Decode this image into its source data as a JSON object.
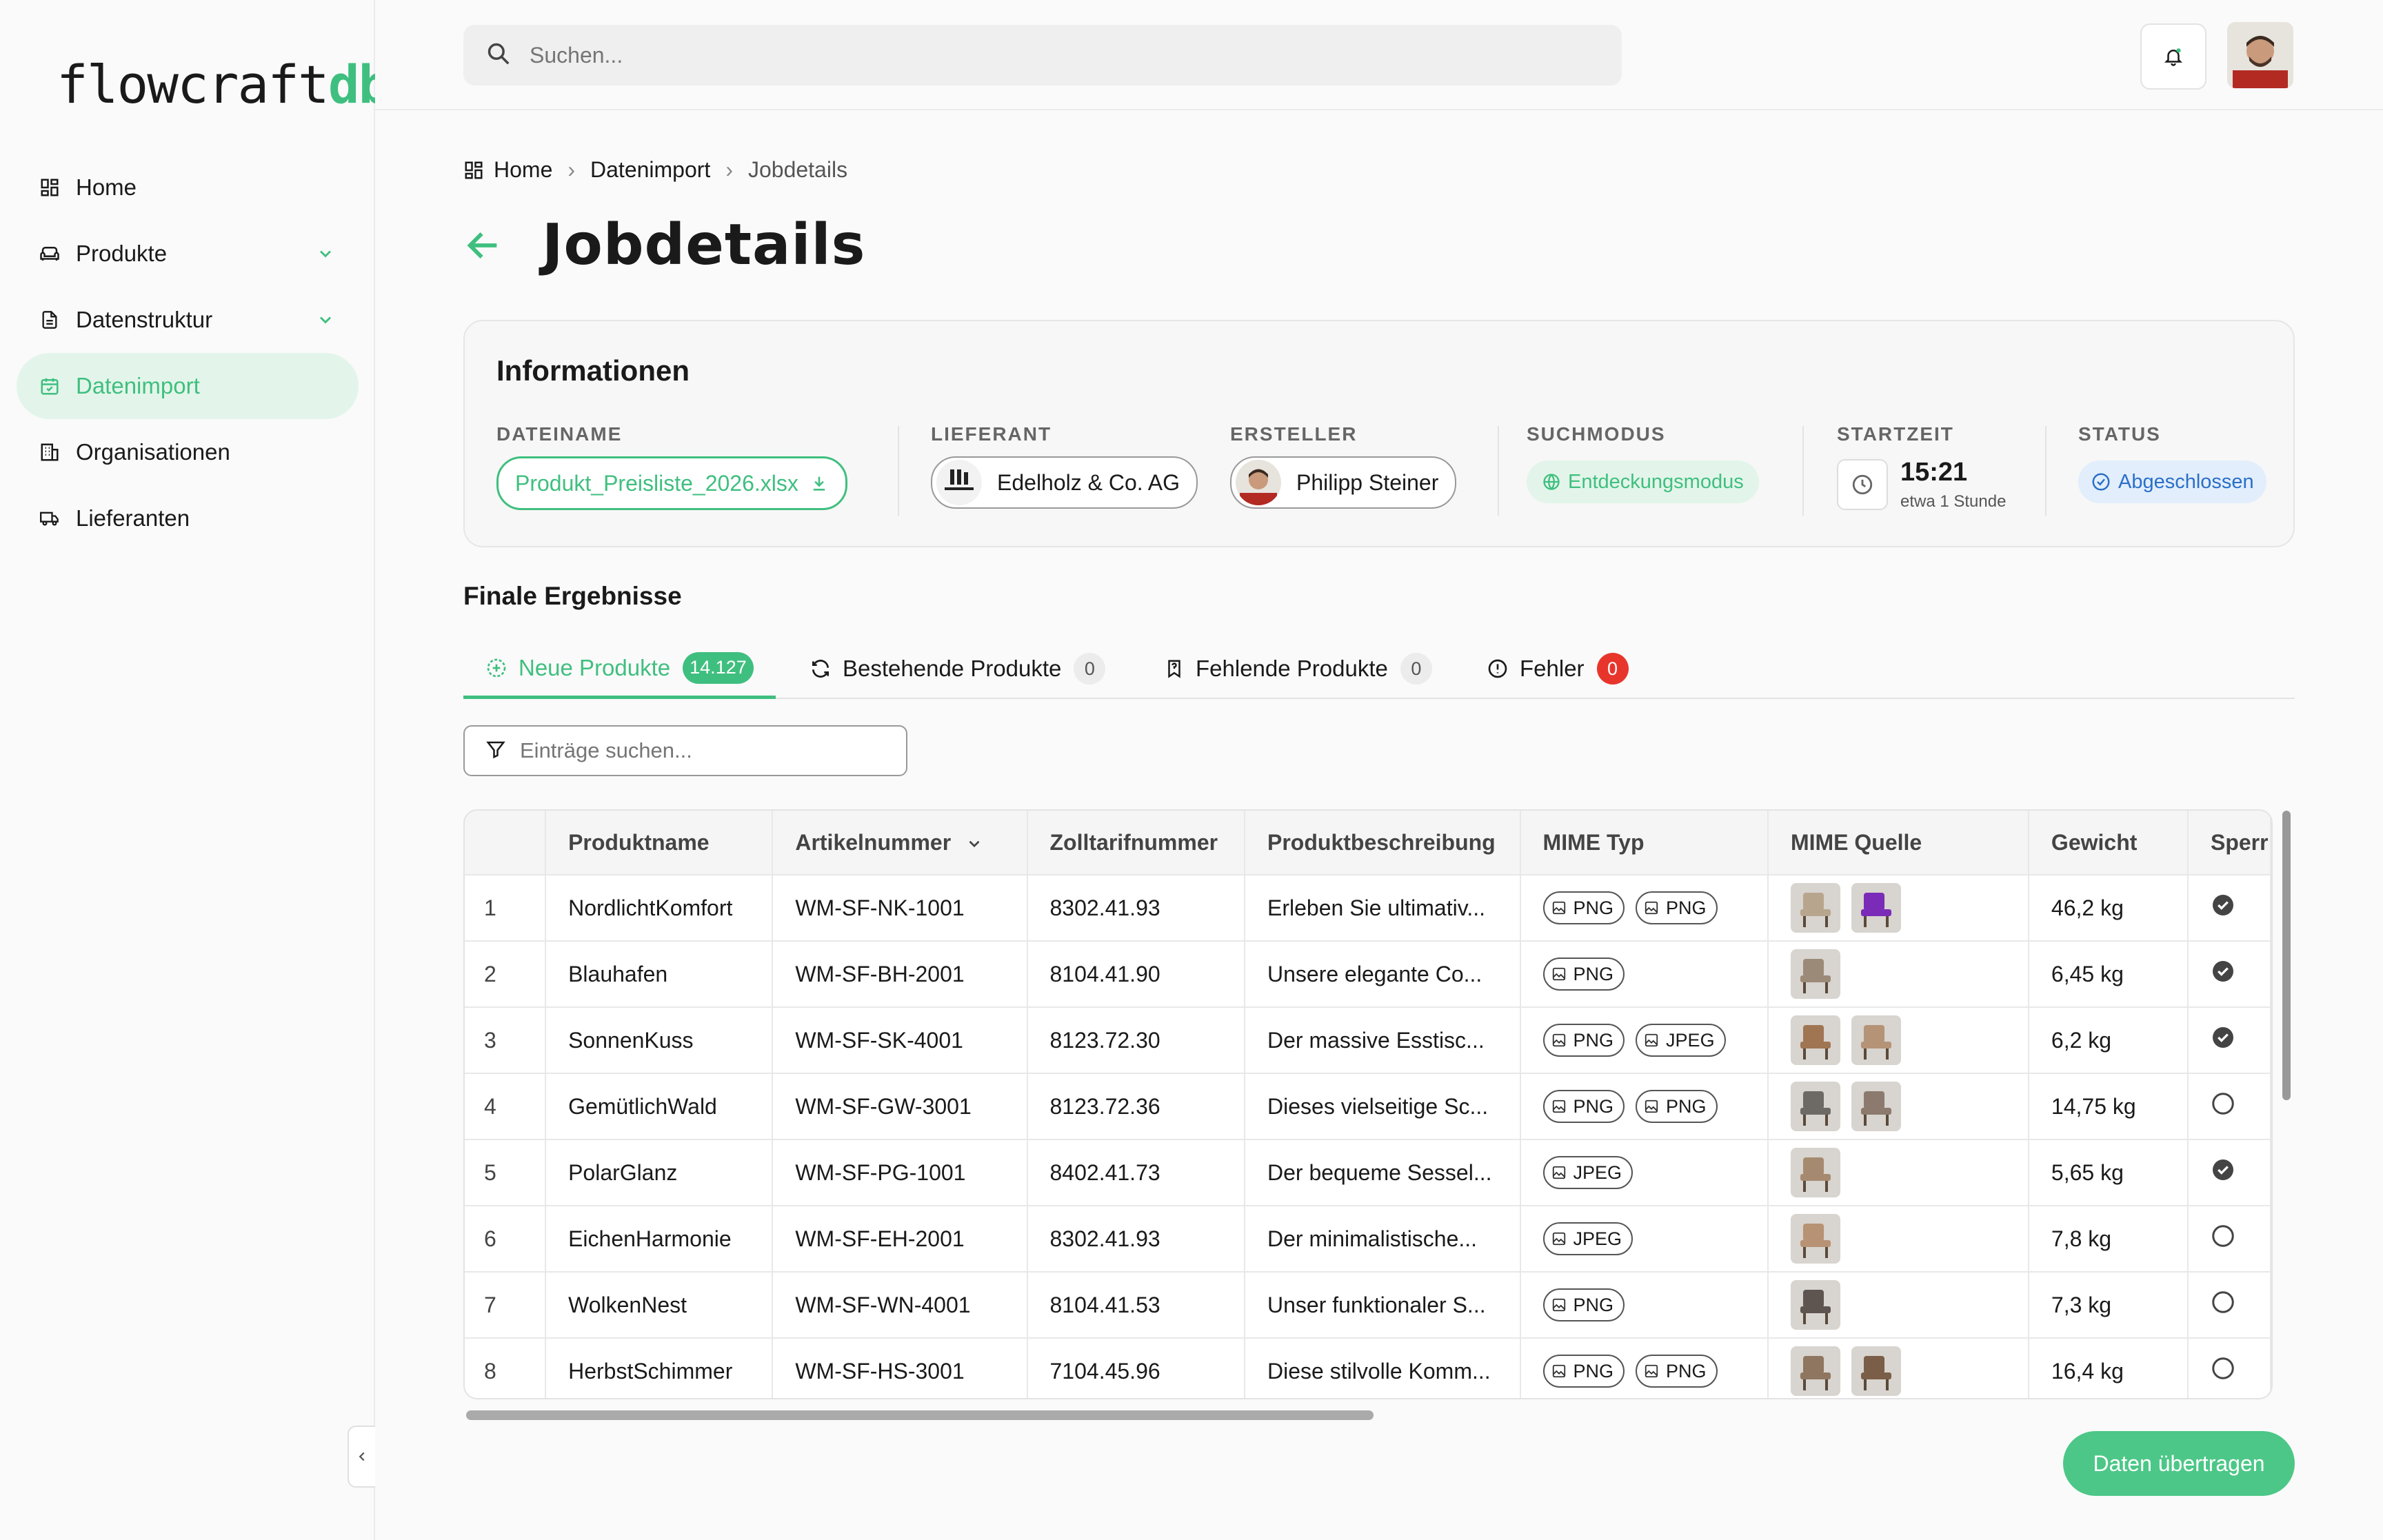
{
  "app": {
    "logo_main": "flowcraft",
    "logo_accent": "db"
  },
  "sidebar": {
    "items": [
      {
        "label": "Home",
        "icon": "dashboard-icon",
        "active": false,
        "has_chevron": false
      },
      {
        "label": "Produkte",
        "icon": "sofa-icon",
        "active": false,
        "has_chevron": true
      },
      {
        "label": "Datenstruktur",
        "icon": "document-icon",
        "active": false,
        "has_chevron": true
      },
      {
        "label": "Datenimport",
        "icon": "calendar-import-icon",
        "active": true,
        "has_chevron": false
      },
      {
        "label": "Organisationen",
        "icon": "building-icon",
        "active": false,
        "has_chevron": false
      },
      {
        "label": "Lieferanten",
        "icon": "truck-icon",
        "active": false,
        "has_chevron": false
      }
    ]
  },
  "topbar": {
    "search_placeholder": "Suchen..."
  },
  "breadcrumb": {
    "home": "Home",
    "level1": "Datenimport",
    "current": "Jobdetails"
  },
  "page": {
    "title": "Jobdetails"
  },
  "info": {
    "heading": "Informationen",
    "filename_label": "DATEINAME",
    "filename": "Produkt_Preisliste_2026.xlsx",
    "supplier_label": "LIEFERANT",
    "supplier": "Edelholz & Co. AG",
    "creator_label": "ERSTELLER",
    "creator": "Philipp Steiner",
    "mode_label": "SUCHMODUS",
    "mode": "Entdeckungsmodus",
    "start_label": "STARTZEIT",
    "start_time": "15:21",
    "start_relative": "etwa 1 Stunde",
    "status_label": "STATUS",
    "status": "Abgeschlossen"
  },
  "results": {
    "title": "Finale Ergebnisse",
    "tabs": [
      {
        "label": "Neue Produkte",
        "count": "14.127"
      },
      {
        "label": "Bestehende Produkte",
        "count": "0"
      },
      {
        "label": "Fehlende Produkte",
        "count": "0"
      },
      {
        "label": "Fehler",
        "count": "0"
      }
    ],
    "search_placeholder": "Einträge suchen...",
    "columns": [
      "",
      "Produktname",
      "Artikelnummer",
      "Zolltarifnummer",
      "Produktbeschreibung",
      "MIME Typ",
      "MIME Quelle",
      "Gewicht",
      "Sperr"
    ],
    "rows": [
      {
        "n": "1",
        "name": "NordlichtKomfort",
        "art": "WM-SF-NK-1001",
        "zoll": "8302.41.93",
        "desc": "Erleben Sie ultimativ...",
        "mime": [
          "PNG",
          "PNG"
        ],
        "thumbs": [
          "#b8a58e",
          "#7a2bb8"
        ],
        "weight": "46,2 kg",
        "locked": true
      },
      {
        "n": "2",
        "name": "Blauhafen",
        "art": "WM-SF-BH-2001",
        "zoll": "8104.41.90",
        "desc": "Unsere elegante Co...",
        "mime": [
          "PNG"
        ],
        "thumbs": [
          "#9c8a78"
        ],
        "weight": "6,45 kg",
        "locked": true
      },
      {
        "n": "3",
        "name": "SonnenKuss",
        "art": "WM-SF-SK-4001",
        "zoll": "8123.72.30",
        "desc": "Der massive Esstisc...",
        "mime": [
          "PNG",
          "JPEG"
        ],
        "thumbs": [
          "#a07552",
          "#b59377"
        ],
        "weight": "6,2 kg",
        "locked": true
      },
      {
        "n": "4",
        "name": "GemütlichWald",
        "art": "WM-SF-GW-3001",
        "zoll": "8123.72.36",
        "desc": "Dieses vielseitige Sc...",
        "mime": [
          "PNG",
          "PNG"
        ],
        "thumbs": [
          "#6d6a66",
          "#8b7a6d"
        ],
        "weight": "14,75 kg",
        "locked": false
      },
      {
        "n": "5",
        "name": "PolarGlanz",
        "art": "WM-SF-PG-1001",
        "zoll": "8402.41.73",
        "desc": "Der bequeme Sessel...",
        "mime": [
          "JPEG"
        ],
        "thumbs": [
          "#a68a70"
        ],
        "weight": "5,65 kg",
        "locked": true
      },
      {
        "n": "6",
        "name": "EichenHarmonie",
        "art": "WM-SF-EH-2001",
        "zoll": "8302.41.93",
        "desc": "Der minimalistische...",
        "mime": [
          "JPEG"
        ],
        "thumbs": [
          "#b89274"
        ],
        "weight": "7,8 kg",
        "locked": false
      },
      {
        "n": "7",
        "name": "WolkenNest",
        "art": "WM-SF-WN-4001",
        "zoll": "8104.41.53",
        "desc": "Unser funktionaler S...",
        "mime": [
          "PNG"
        ],
        "thumbs": [
          "#5e5550"
        ],
        "weight": "7,3 kg",
        "locked": false
      },
      {
        "n": "8",
        "name": "HerbstSchimmer",
        "art": "WM-SF-HS-3001",
        "zoll": "7104.45.96",
        "desc": "Diese stilvolle Komm...",
        "mime": [
          "PNG",
          "PNG"
        ],
        "thumbs": [
          "#8e7660",
          "#7a5e48"
        ],
        "weight": "16,4 kg",
        "locked": false
      }
    ]
  },
  "actions": {
    "transfer": "Daten übertragen"
  },
  "colors": {
    "accent": "#3fbf7f",
    "error": "#e8352c",
    "status_blue": "#2a6fc9"
  }
}
